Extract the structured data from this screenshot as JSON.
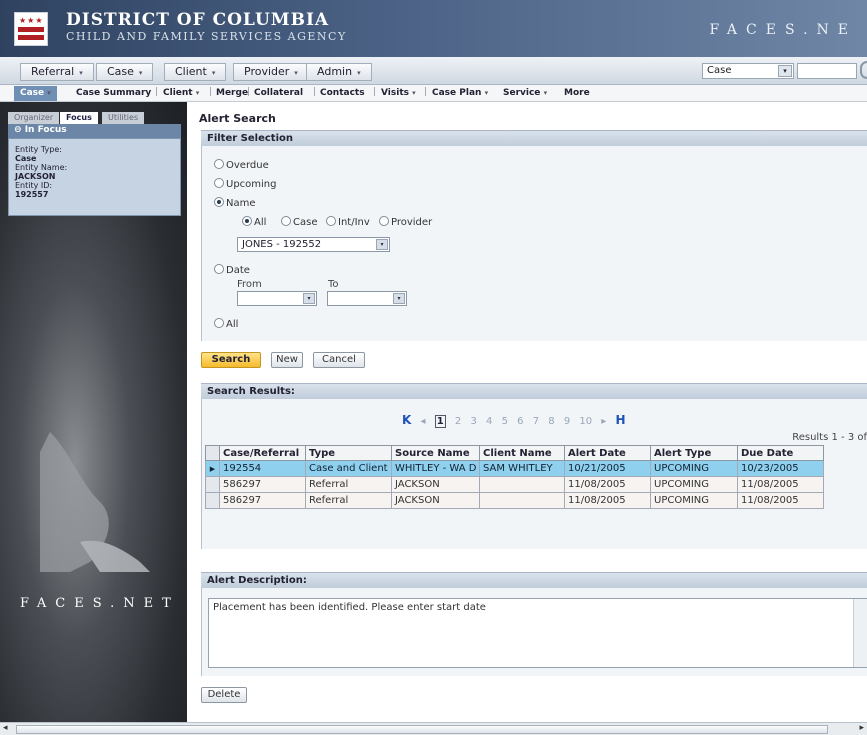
{
  "header": {
    "org_line1": "DISTRICT OF COLUMBIA",
    "org_line2": "CHILD AND FAMILY SERVICES AGENCY",
    "brand": "FACES.NE"
  },
  "menu": {
    "items": [
      "Referral",
      "Case",
      "Client",
      "Provider",
      "Admin"
    ],
    "entity_select": "Case"
  },
  "subnav": {
    "items": [
      "Case",
      "Case Summary",
      "Client",
      "Merge",
      "Collateral",
      "Contacts",
      "Visits",
      "Case Plan",
      "Service",
      "More"
    ]
  },
  "left": {
    "tabs": [
      "Organizer",
      "Focus",
      "Utilities"
    ],
    "focus_header": "In Focus",
    "entity_type_label": "Entity Type:",
    "entity_type": "Case",
    "entity_name_label": "Entity Name:",
    "entity_name": "JACKSON",
    "entity_id_label": "Entity ID:",
    "entity_id": "192557",
    "brand": "FACES.NET"
  },
  "main": {
    "title": "Alert Search",
    "filter_header": "Filter Selection",
    "filter": {
      "overdue": "Overdue",
      "upcoming": "Upcoming",
      "name": "Name",
      "sub_all": "All",
      "sub_case": "Case",
      "sub_intinv": "Int/Inv",
      "sub_provider": "Provider",
      "name_select": "JONES - 192552",
      "date": "Date",
      "from_label": "From",
      "to_label": "To",
      "all": "All"
    },
    "buttons": {
      "search": "Search",
      "new": "New",
      "cancel": "Cancel",
      "delete": "Delete"
    },
    "results_header": "Search Results:",
    "pager": {
      "first": "K",
      "prev": "◂",
      "pages": [
        "1",
        "2",
        "3",
        "4",
        "5",
        "6",
        "7",
        "8",
        "9",
        "10"
      ],
      "next": "▸",
      "last": "H"
    },
    "results_count": "Results 1 - 3 of",
    "columns": [
      "Case/Referral",
      "Type",
      "Source Name",
      "Client Name",
      "Alert Date",
      "Alert Type",
      "Due Date"
    ],
    "rows": [
      [
        "192554",
        "Case and Client",
        "WHITLEY - WA D",
        "SAM WHITLEY",
        "10/21/2005",
        "UPCOMING",
        "10/23/2005"
      ],
      [
        "586297",
        "Referral",
        "JACKSON",
        "",
        "11/08/2005",
        "UPCOMING",
        "11/08/2005"
      ],
      [
        "586297",
        "Referral",
        "JACKSON",
        "",
        "11/08/2005",
        "UPCOMING",
        "11/08/2005"
      ]
    ],
    "desc_header": "Alert Description:",
    "description": "Placement has been identified. Please enter start date"
  }
}
